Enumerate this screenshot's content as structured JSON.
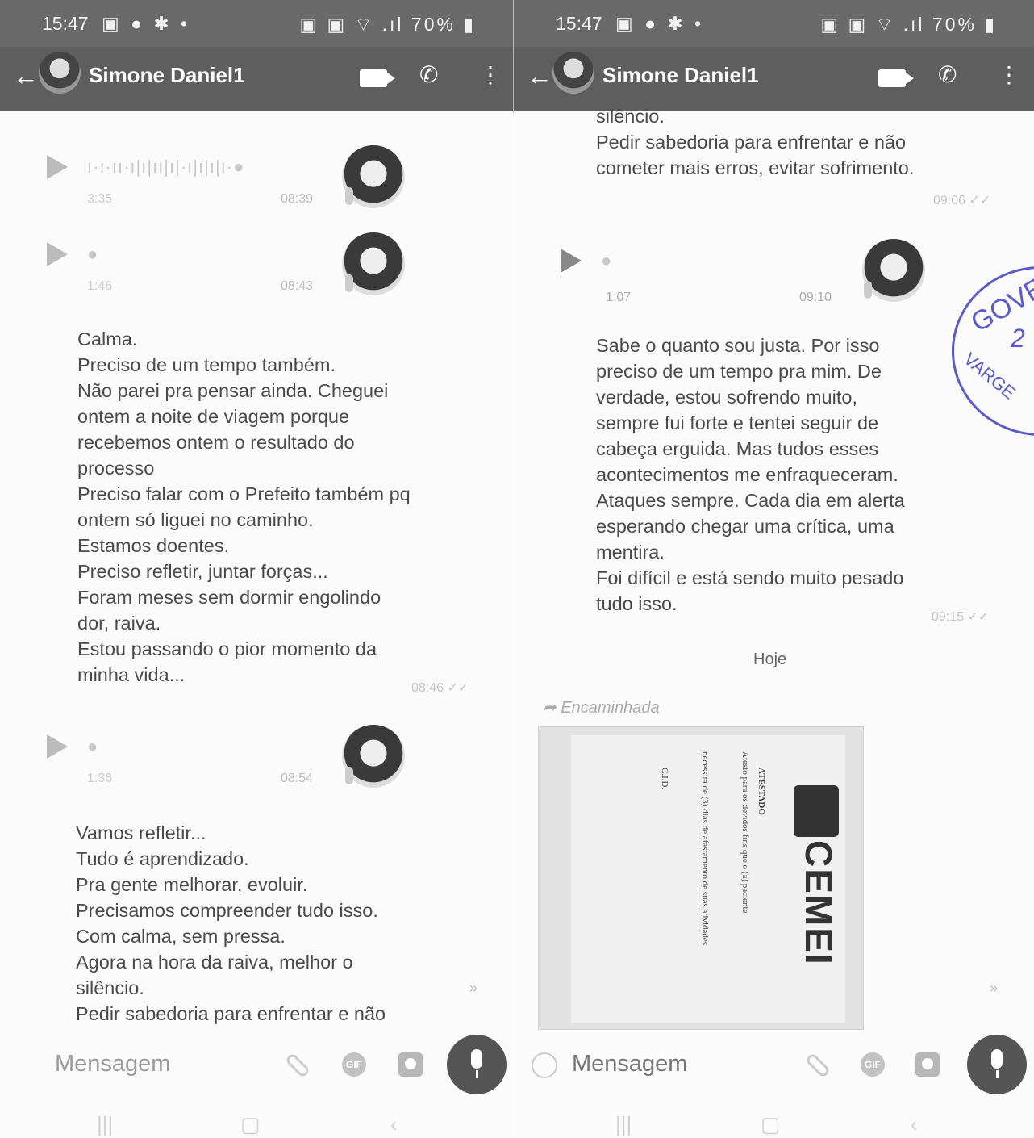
{
  "status": {
    "time": "15:47",
    "battery": "70%"
  },
  "contact": {
    "name": "Simone Daniel1"
  },
  "left": {
    "voice_messages": [
      {
        "duration": "3:35",
        "time": "08:39"
      },
      {
        "duration": "1:46",
        "time": "08:43"
      },
      {
        "duration": "1:36",
        "time": "08:54"
      }
    ],
    "message1": {
      "text": "Calma.\nPreciso de um tempo também.\nNão parei pra pensar ainda. Cheguei\nontem a noite de viagem porque\nrecebemos ontem o resultado do\nprocesso\nPreciso falar com o Prefeito também pq\nontem só liguei no caminho.\nEstamos doentes.\nPreciso refletir, juntar forças...\nForam meses sem dormir   engolindo\ndor, raiva.\nEstou passando o pior momento da\nminha vida...",
      "time": "08:46"
    },
    "message2": {
      "text": "Vamos refletir...\nTudo é aprendizado.\nPra gente melhorar, evoluir.\nPrecisamos compreender tudo isso.\nCom calma, sem pressa.\nAgora na hora da raiva, melhor o\nsilêncio.\nPedir sabedoria para enfrentar e não"
    },
    "input_placeholder": "Mensagem"
  },
  "right": {
    "message_top": {
      "text": "silêncio.\nPedir sabedoria para enfrentar e não\ncometer mais erros,  evitar sofrimento.",
      "time": "09:06"
    },
    "voice_message": {
      "duration": "1:07",
      "time": "09:10"
    },
    "message3": {
      "text": "Sabe o quanto sou justa. Por isso\npreciso de um tempo pra mim. De\nverdade, estou sofrendo muito,\nsempre fui forte e tentei seguir de\ncabeça erguida. Mas tudos esses\nacontecimentos me enfraqueceram.\nAtaques sempre. Cada dia em alerta\nesperando chegar uma crítica, uma\nmentira.\nFoi difícil e está sendo muito pesado\ntudo isso.",
      "time": "09:15"
    },
    "date_separator": "Hoje",
    "forwarded_label": "Encaminhada",
    "attachment": {
      "brand": "CEMEI",
      "title": "ATESTADO",
      "line1": "Atesto para os devidos fins que o (a) paciente",
      "line2": "necessita de (3) dias de afastamento de suas atividades",
      "line3": "C.I.D."
    },
    "input_placeholder": "Mensagem"
  },
  "stamp": {
    "line1": "GOVER",
    "line2": "2",
    "line3": "VARGE"
  },
  "colors": {
    "header": "#5e5e5e",
    "stamp": "#5b5bc9",
    "text": "#4a4a4a"
  }
}
